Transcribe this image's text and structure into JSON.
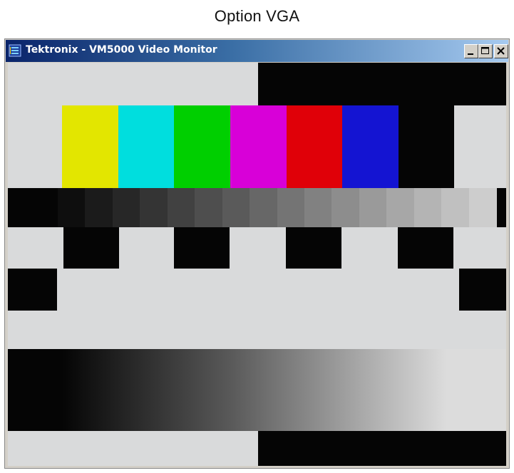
{
  "caption": "Option VGA",
  "window": {
    "title": "Tektronix - VM5000 Video Monitor",
    "icon": "tektronix-app-icon",
    "controls": {
      "minimize": "minimize-icon",
      "maximize": "maximize-icon",
      "close": "close-icon"
    }
  },
  "test_pattern": {
    "background": "#d9dadb",
    "black": "#050505",
    "color_bars": [
      "#e3e600",
      "#00dede",
      "#00cf00",
      "#d800d8",
      "#e00008",
      "#1414d2"
    ],
    "grey_steps": 16,
    "gradient": [
      "#050505",
      "#dcdcdc"
    ]
  }
}
